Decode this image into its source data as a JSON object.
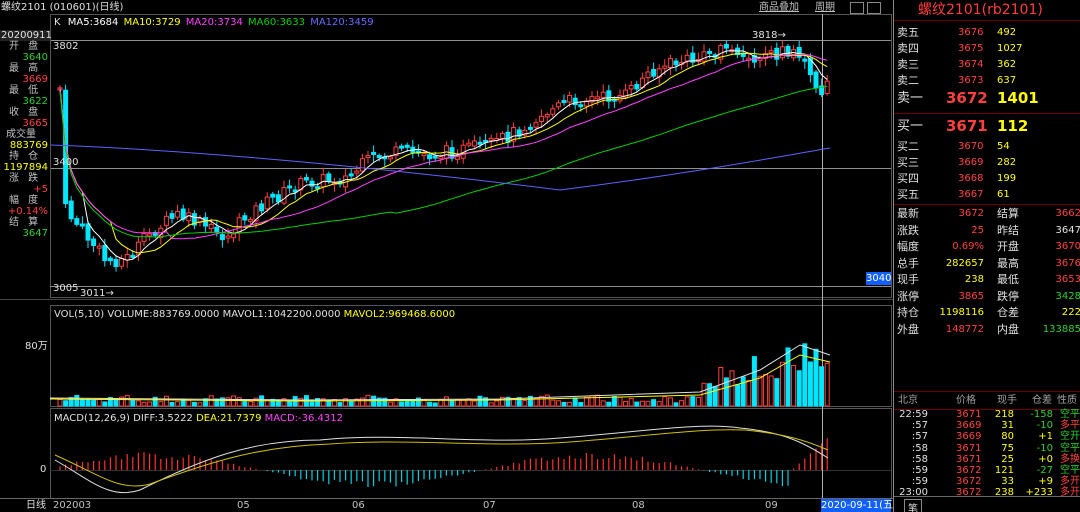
{
  "top_bar": {
    "symbol_title": "螺纹2101 (010601)",
    "period_tag": "(日线)",
    "product_overlay_button": "商品叠加",
    "cycle_button": "周期"
  },
  "ma_legend": {
    "k": "K",
    "ma5": "MA5:3684",
    "ma10": "MA10:3729",
    "ma20": "MA20:3734",
    "ma60": "MA60:3633",
    "ma120": "MA120:3459"
  },
  "colors": {
    "up": "#ff4040",
    "down": "#00e6ff",
    "ma5": "#ffffff",
    "ma10": "#ffff00",
    "ma20": "#ff40ff",
    "ma60": "#00d000",
    "ma120": "#6060ff"
  },
  "price_axis": {
    "top_label": "3802",
    "mid_label": "3400",
    "low_label": "3005",
    "high_marker": "3818",
    "low_marker": "3011",
    "cursor_price": "3040"
  },
  "info_panel": {
    "date": "20200911",
    "open_label": "开 盘",
    "open_value": "3640",
    "high_label": "最 高",
    "high_value": "3669",
    "low_label": "最 低",
    "low_value": "3622",
    "close_label": "收 盘",
    "close_value": "3665",
    "volume_label": "成交量",
    "volume_value": "883769",
    "oi_label": "持 仓",
    "oi_value": "1197894",
    "change_label": "涨 跌",
    "change_value": "+5",
    "pct_label": "幅 度",
    "pct_value": "+0.14%",
    "settle_label": "结 算",
    "settle_value": "3647"
  },
  "volume_panel": {
    "legend_name": "VOL(5,10)",
    "volume": "VOLUME:883769.0000",
    "mavol1": "MAVOL1:1042200.0000",
    "mavol2": "MAVOL2:969468.6000",
    "axis_label": "80万"
  },
  "macd_panel": {
    "legend_name": "MACD(12,26,9)",
    "diff": "DIFF:3.5222",
    "dea": "DEA:21.7379",
    "macd": "MACD:-36.4312",
    "zero_label": "0"
  },
  "time_axis": {
    "left_label": "日线",
    "ticks": [
      "202003",
      "05",
      "06",
      "07",
      "08",
      "09"
    ],
    "cursor_date": "2020-09-11(五)"
  },
  "right_panel": {
    "title": "螺纹2101(rb2101)",
    "asks": [
      {
        "label": "卖五",
        "price": "3676",
        "qty": "492"
      },
      {
        "label": "卖四",
        "price": "3675",
        "qty": "1027"
      },
      {
        "label": "卖三",
        "price": "3674",
        "qty": "362"
      },
      {
        "label": "卖二",
        "price": "3673",
        "qty": "637"
      },
      {
        "label": "卖一",
        "price": "3672",
        "qty": "1401"
      }
    ],
    "bids": [
      {
        "label": "买一",
        "price": "3671",
        "qty": "112"
      },
      {
        "label": "买二",
        "price": "3670",
        "qty": "54"
      },
      {
        "label": "买三",
        "price": "3669",
        "qty": "282"
      },
      {
        "label": "买四",
        "price": "3668",
        "qty": "199"
      },
      {
        "label": "买五",
        "price": "3667",
        "qty": "61"
      }
    ],
    "stats": [
      {
        "l1": "最新",
        "v1": "3672",
        "l2": "结算",
        "v2": "3662"
      },
      {
        "l1": "涨跌",
        "v1": "25",
        "l2": "昨结",
        "v2": "3647"
      },
      {
        "l1": "幅度",
        "v1": "0.69%",
        "l2": "开盘",
        "v2": "3670"
      },
      {
        "l1": "总手",
        "v1": "282657",
        "l2": "最高",
        "v2": "3676"
      },
      {
        "l1": "现手",
        "v1": "238",
        "l2": "最低",
        "v2": "3653"
      },
      {
        "l1": "涨停",
        "v1": "3865",
        "l2": "跌停",
        "v2": "3428"
      },
      {
        "l1": "持仓",
        "v1": "1198116",
        "l2": "仓差",
        "v2": "222"
      },
      {
        "l1": "外盘",
        "v1": "148772",
        "l2": "内盘",
        "v2": "133885"
      }
    ],
    "ticks_header": {
      "loc": "北京",
      "price": "价格",
      "vol": "现手",
      "oi": "仓差",
      "nature": "性质"
    },
    "ticks": [
      {
        "time": "22:59",
        "price": "3671",
        "vol": "218",
        "oi": "-158",
        "nature": "空平"
      },
      {
        "time": ":57",
        "price": "3669",
        "vol": "31",
        "oi": "-10",
        "nature": "多平"
      },
      {
        "time": ":57",
        "price": "3669",
        "vol": "80",
        "oi": "+1",
        "nature": "空开"
      },
      {
        "time": ":58",
        "price": "3671",
        "vol": "75",
        "oi": "-10",
        "nature": "空平"
      },
      {
        "time": ":58",
        "price": "3671",
        "vol": "25",
        "oi": "+0",
        "nature": "多换"
      },
      {
        "time": ":59",
        "price": "3672",
        "vol": "121",
        "oi": "-27",
        "nature": "空平"
      },
      {
        "time": ":59",
        "price": "3672",
        "vol": "33",
        "oi": "+9",
        "nature": "多开"
      },
      {
        "time": "23:00",
        "price": "3672",
        "vol": "238",
        "oi": "+233",
        "nature": "多开"
      }
    ],
    "bottom_tab": "笔"
  }
}
